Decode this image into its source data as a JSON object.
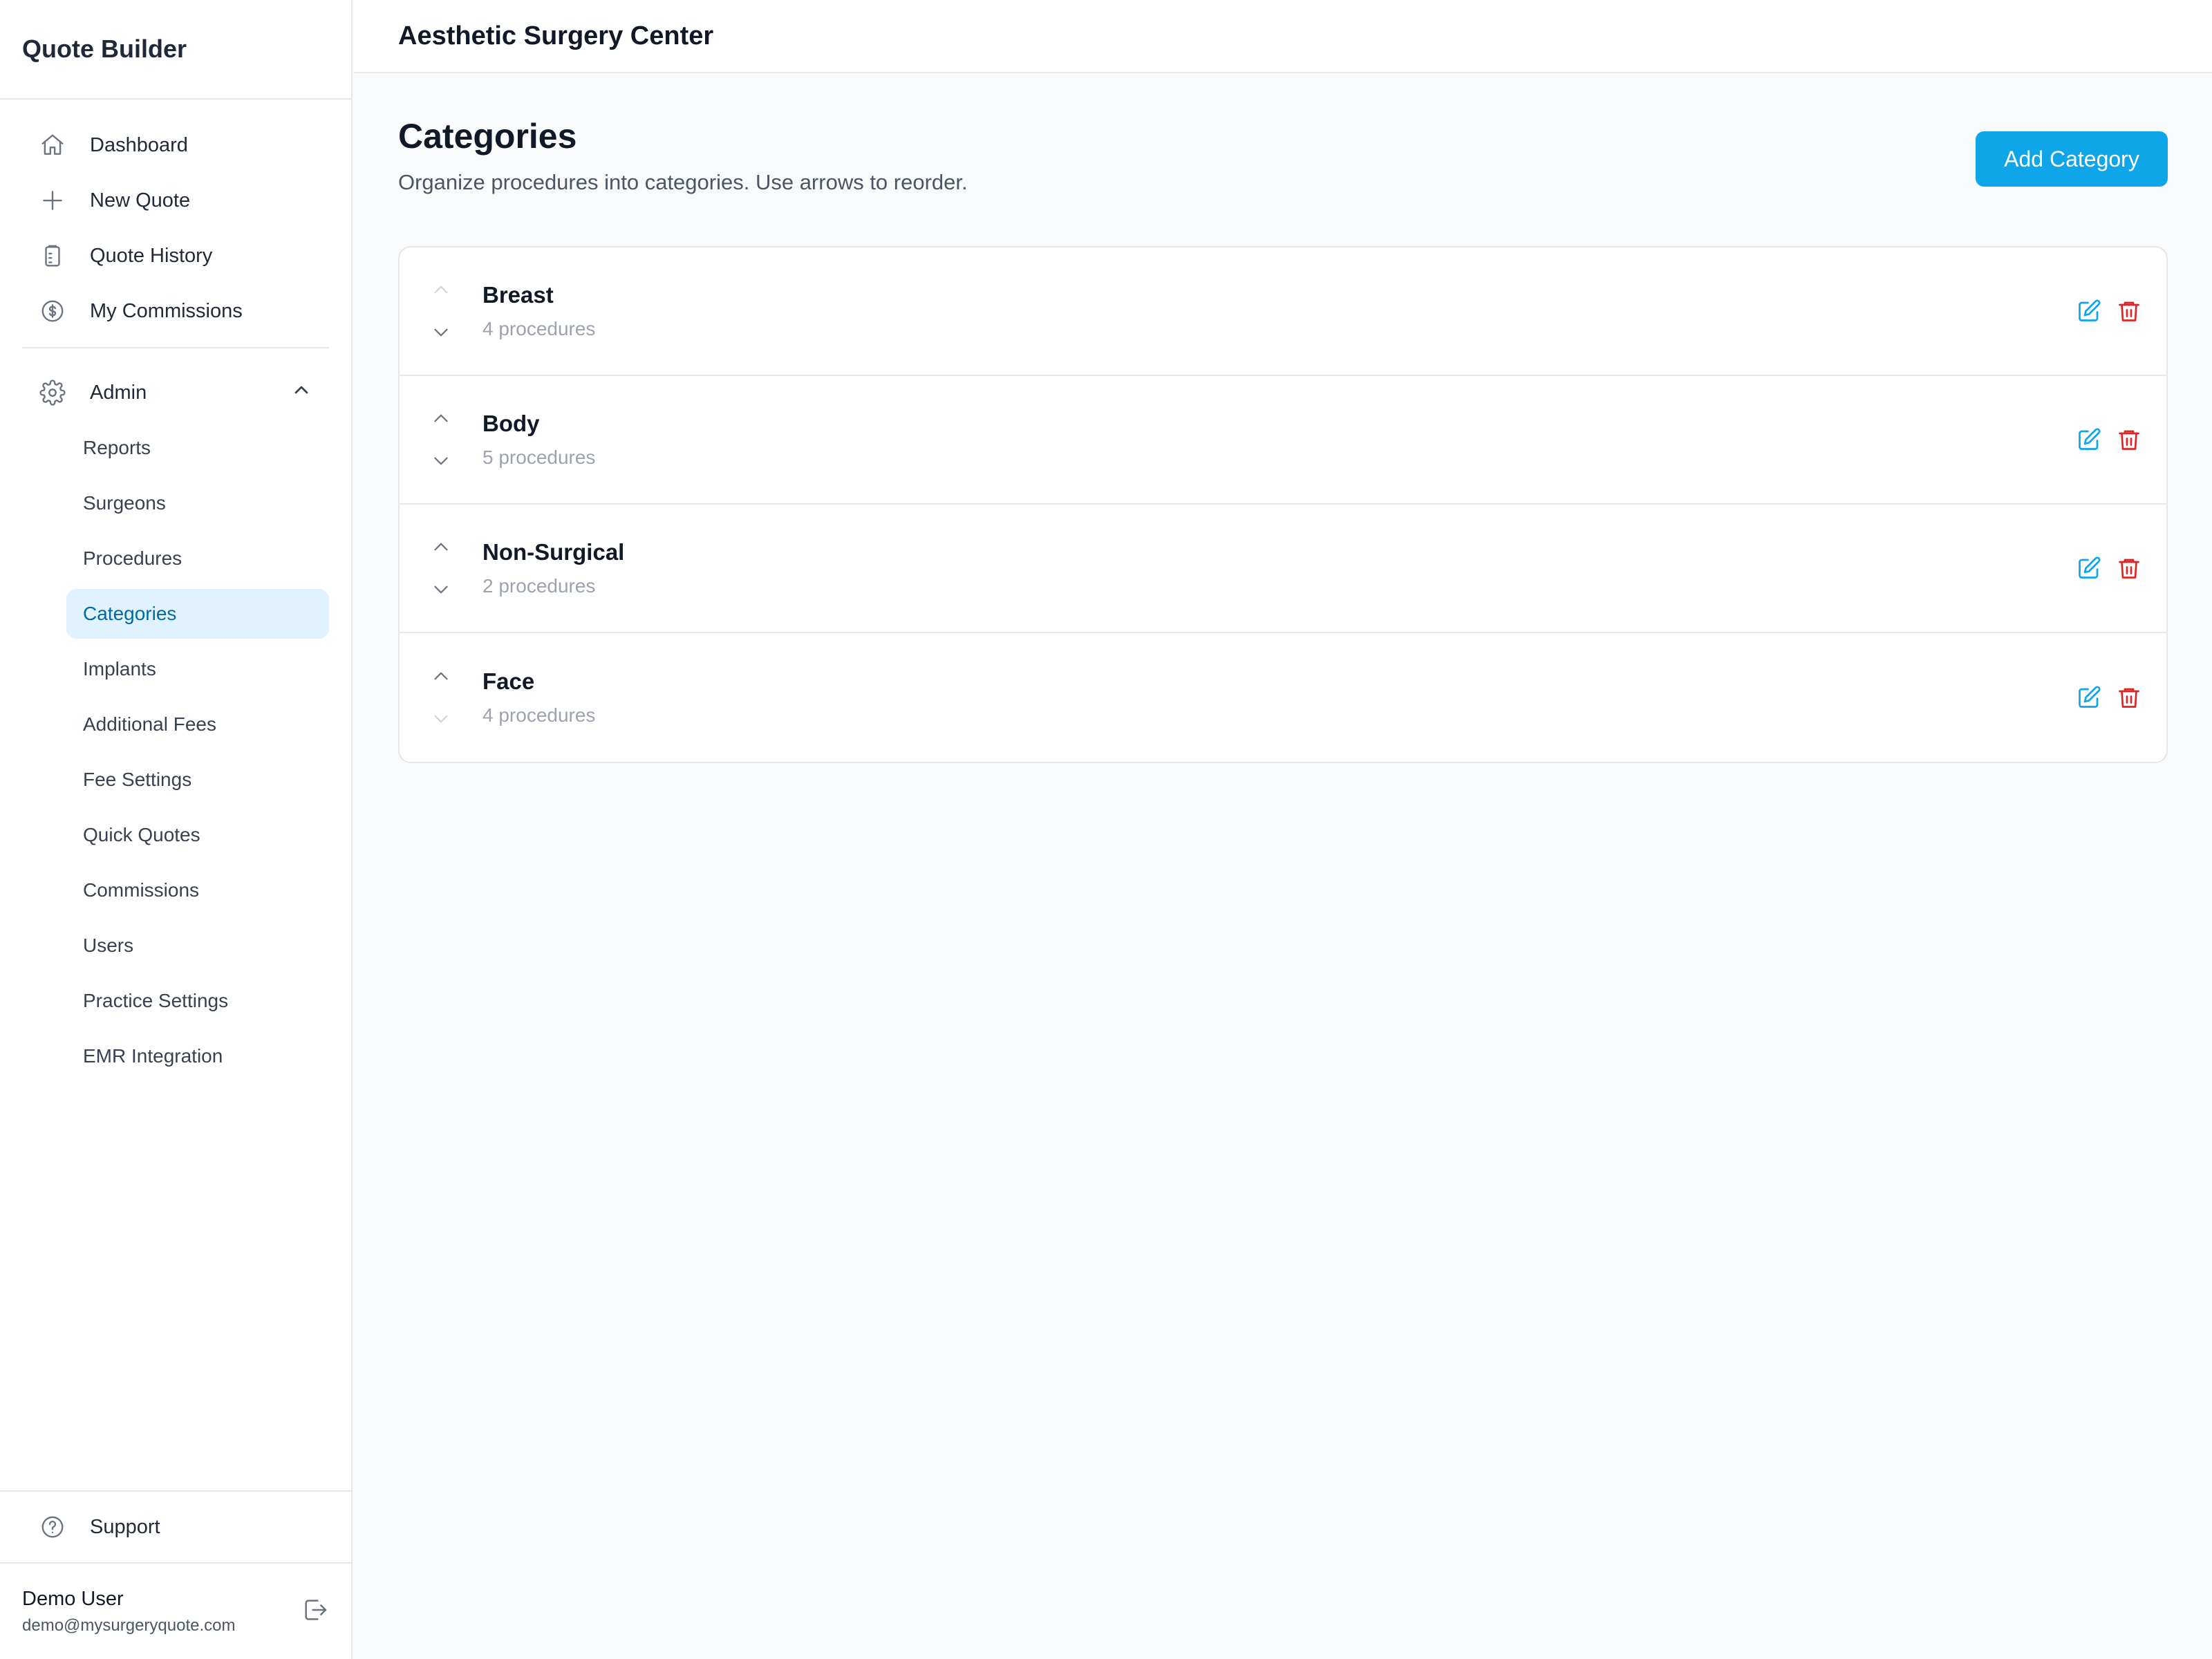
{
  "sidebar": {
    "brand": "Quote Builder",
    "nav": [
      {
        "label": "Dashboard",
        "icon": "home-icon"
      },
      {
        "label": "New Quote",
        "icon": "plus-icon"
      },
      {
        "label": "Quote History",
        "icon": "clipboard-icon"
      },
      {
        "label": "My Commissions",
        "icon": "dollar-circle-icon"
      }
    ],
    "admin": {
      "label": "Admin",
      "icon": "gear-icon",
      "expanded": true
    },
    "admin_items": [
      "Reports",
      "Surgeons",
      "Procedures",
      "Categories",
      "Implants",
      "Additional Fees",
      "Fee Settings",
      "Quick Quotes",
      "Commissions",
      "Users",
      "Practice Settings",
      "EMR Integration"
    ],
    "active_item": "Categories",
    "support": "Support",
    "user": {
      "name": "Demo User",
      "email": "demo@mysurgeryquote.com"
    }
  },
  "header": {
    "org_name": "Aesthetic Surgery Center"
  },
  "page": {
    "title": "Categories",
    "subtitle": "Organize procedures into categories. Use arrows to reorder.",
    "add_button": "Add Category"
  },
  "categories": [
    {
      "name": "Breast",
      "count": "4 procedures",
      "up_disabled": true,
      "down_disabled": false
    },
    {
      "name": "Body",
      "count": "5 procedures",
      "up_disabled": false,
      "down_disabled": false
    },
    {
      "name": "Non-Surgical",
      "count": "2 procedures",
      "up_disabled": false,
      "down_disabled": false
    },
    {
      "name": "Face",
      "count": "4 procedures",
      "up_disabled": false,
      "down_disabled": true
    }
  ],
  "colors": {
    "accent": "#0ea5e9",
    "active_bg": "#e0f2fe",
    "active_text": "#0369a1",
    "edit": "#0ea5e9",
    "delete": "#dc2626"
  }
}
